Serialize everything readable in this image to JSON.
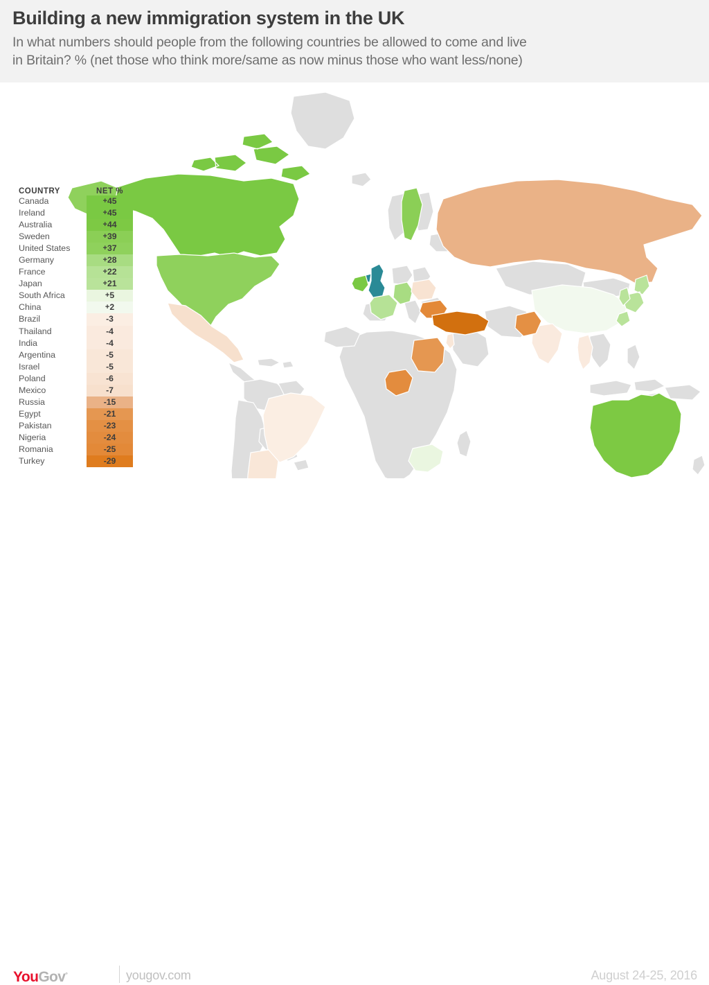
{
  "header": {
    "title": "Building a new immigration system in the UK",
    "subtitle_line1": "In what numbers should people from the following countries be allowed to come and live",
    "subtitle_line2": "in Britain? % (net those who think more/same as now minus those who want less/none)"
  },
  "table": {
    "col_country": "COUNTRY",
    "col_net": "NET %"
  },
  "footer": {
    "logo_you": "You",
    "logo_gov": "Gov",
    "logo_reg": "°",
    "logo_url": "yougov.com",
    "date": "August 24-25, 2016"
  },
  "colors": {
    "header_bg": "#f2f2f2",
    "page_bg": "#ffffff",
    "map_default": "#dedede",
    "map_reference": "#2a8a96",
    "title_text": "#3d3d3d",
    "subtitle_text": "#6e6e6e",
    "brand_red": "#e8112d",
    "brand_grey": "#b3b3b3"
  },
  "chart_data": {
    "type": "bar",
    "title": "Building a new immigration system in the UK",
    "subtitle": "In what numbers should people from the following countries be allowed to come and live in Britain? % (net those who think more/same as now minus those who want less/none)",
    "xlabel": "",
    "ylabel": "NET %",
    "source": "yougov.com",
    "date": "August 24-25, 2016",
    "categories": [
      "Canada",
      "Ireland",
      "Australia",
      "Sweden",
      "United States",
      "Germany",
      "France",
      "Japan",
      "South Africa",
      "China",
      "Brazil",
      "Thailand",
      "India",
      "Argentina",
      "Israel",
      "Poland",
      "Mexico",
      "Russia",
      "Egypt",
      "Pakistan",
      "Nigeria",
      "Romania",
      "Turkey"
    ],
    "values": [
      45,
      45,
      44,
      39,
      37,
      28,
      22,
      21,
      5,
      2,
      -3,
      -4,
      -4,
      -5,
      -5,
      -6,
      -7,
      -15,
      -21,
      -23,
      -24,
      -25,
      -29
    ],
    "ylim": [
      -29,
      45
    ],
    "grid": false,
    "legend": "none",
    "rows": [
      {
        "country": "Canada",
        "net": 45,
        "label": "+45",
        "swatch": "#7ac943"
      },
      {
        "country": "Ireland",
        "net": 45,
        "label": "+45",
        "swatch": "#7ac943"
      },
      {
        "country": "Australia",
        "net": 44,
        "label": "+44",
        "swatch": "#7dc944"
      },
      {
        "country": "Sweden",
        "net": 39,
        "label": "+39",
        "swatch": "#8bcf56"
      },
      {
        "country": "United States",
        "net": 37,
        "label": "+37",
        "swatch": "#8fd15c"
      },
      {
        "country": "Germany",
        "net": 28,
        "label": "+28",
        "swatch": "#a8dc82"
      },
      {
        "country": "France",
        "net": 22,
        "label": "+22",
        "swatch": "#b6e296"
      },
      {
        "country": "Japan",
        "net": 21,
        "label": "+21",
        "swatch": "#b9e39a"
      },
      {
        "country": "South Africa",
        "net": 5,
        "label": "+5",
        "swatch": "#eaf6e0"
      },
      {
        "country": "China",
        "net": 2,
        "label": "+2",
        "swatch": "#f2f9ee"
      },
      {
        "country": "Brazil",
        "net": -3,
        "label": "-3",
        "swatch": "#fbeee3"
      },
      {
        "country": "Thailand",
        "net": -4,
        "label": "-4",
        "swatch": "#faeade"
      },
      {
        "country": "India",
        "net": -4,
        "label": "-4",
        "swatch": "#faeade"
      },
      {
        "country": "Argentina",
        "net": -5,
        "label": "-5",
        "swatch": "#f9e7d8"
      },
      {
        "country": "Israel",
        "net": -5,
        "label": "-5",
        "swatch": "#f9e7d8"
      },
      {
        "country": "Poland",
        "net": -6,
        "label": "-6",
        "swatch": "#f8e3d2"
      },
      {
        "country": "Mexico",
        "net": -7,
        "label": "-7",
        "swatch": "#f7e0cd"
      },
      {
        "country": "Russia",
        "net": -15,
        "label": "-15",
        "swatch": "#eab287"
      },
      {
        "country": "Egypt",
        "net": -21,
        "label": "-21",
        "swatch": "#e59751"
      },
      {
        "country": "Pakistan",
        "net": -23,
        "label": "-23",
        "swatch": "#e49044"
      },
      {
        "country": "Nigeria",
        "net": -24,
        "label": "-24",
        "swatch": "#e38c3e"
      },
      {
        "country": "Romania",
        "net": -25,
        "label": "-25",
        "swatch": "#e38938"
      },
      {
        "country": "Turkey",
        "net": -29,
        "label": "-29",
        "swatch": "#df7c1e"
      }
    ],
    "map_countries": [
      {
        "name": "Canada",
        "fill": "#7ac943"
      },
      {
        "name": "United States",
        "fill": "#8fd15c"
      },
      {
        "name": "Mexico",
        "fill": "#f7e0cd"
      },
      {
        "name": "Brazil",
        "fill": "#fbeee3"
      },
      {
        "name": "Argentina",
        "fill": "#f9e7d8"
      },
      {
        "name": "United Kingdom",
        "fill": "#2a8a96"
      },
      {
        "name": "Ireland",
        "fill": "#7ac943"
      },
      {
        "name": "Sweden",
        "fill": "#8bcf56"
      },
      {
        "name": "Germany",
        "fill": "#a8dc82"
      },
      {
        "name": "France",
        "fill": "#b6e296"
      },
      {
        "name": "Poland",
        "fill": "#f8e3d2"
      },
      {
        "name": "Romania",
        "fill": "#e38938"
      },
      {
        "name": "Turkey",
        "fill": "#d2700f"
      },
      {
        "name": "Russia",
        "fill": "#eab287"
      },
      {
        "name": "Israel",
        "fill": "#f9e7d8"
      },
      {
        "name": "Egypt",
        "fill": "#e59751"
      },
      {
        "name": "Nigeria",
        "fill": "#e38c3e"
      },
      {
        "name": "South Africa",
        "fill": "#eaf6e0"
      },
      {
        "name": "China",
        "fill": "#f2f9ee"
      },
      {
        "name": "India",
        "fill": "#faeade"
      },
      {
        "name": "Thailand",
        "fill": "#faeade"
      },
      {
        "name": "Pakistan",
        "fill": "#e49044"
      },
      {
        "name": "Japan",
        "fill": "#b9e39a"
      },
      {
        "name": "Australia",
        "fill": "#7dc944"
      }
    ]
  }
}
